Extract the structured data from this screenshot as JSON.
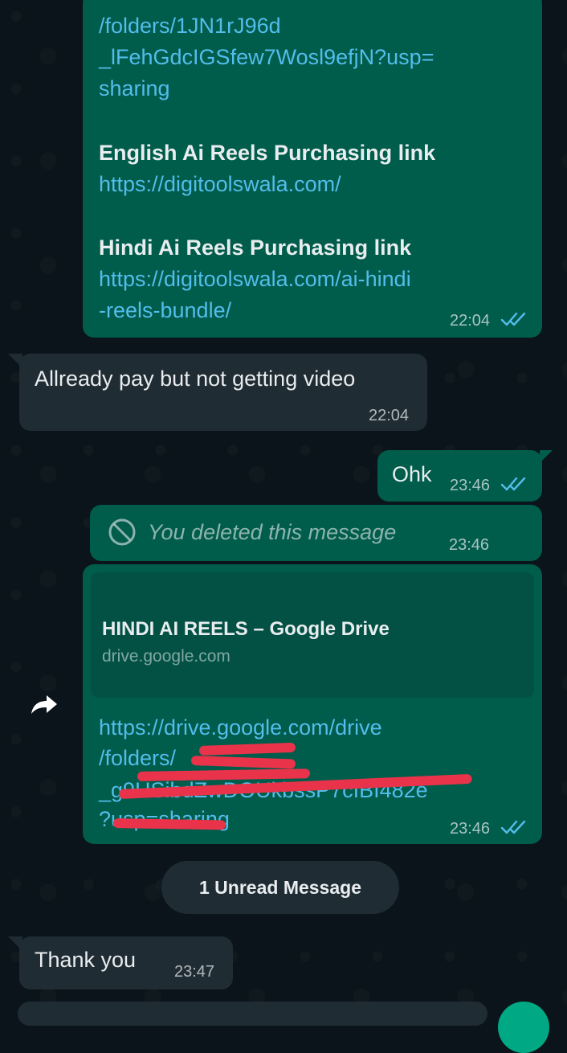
{
  "messages": {
    "m1": {
      "lines": [
        "/folders/1JN1rJ96d",
        "_lFehGdcIGSfew7Wosl9efjN?usp=",
        "sharing"
      ],
      "english_heading": "English Ai Reels Purchasing link",
      "english_link": "https://digitoolswala.com/",
      "hindi_heading": "Hindi Ai Reels Purchasing link",
      "hindi_link_1": "https://digitoolswala.com/ai-hindi",
      "hindi_link_2": "-reels-bundle/",
      "time": "22:04"
    },
    "m2": {
      "text": "Allready pay but not getting video",
      "time": "22:04"
    },
    "m3": {
      "text": "Ohk",
      "time": "23:46"
    },
    "m4": {
      "text": "You deleted this message",
      "time": "23:46"
    },
    "m5": {
      "preview_title": "HINDI AI REELS – Google Drive",
      "preview_domain": "drive.google.com",
      "link_line_1": "https://drive.google.com/drive",
      "link_line_2": "/folders/",
      "link_line_3": "_g9HSibdZwDOUkbssP7cIBI482e",
      "link_line_4": "?usp=sharing",
      "time": "23:46"
    },
    "m6": {
      "text": "Thank you",
      "time": "23:47"
    }
  },
  "unread_divider": "1 Unread Message",
  "icons": {
    "read_ticks": "double-check-icon",
    "deleted": "blocked-icon",
    "forward": "forward-arrow-icon"
  },
  "colors": {
    "background": "#0b141a",
    "outgoing_bubble": "#005c4b",
    "incoming_bubble": "#202c33",
    "link": "#53bdeb",
    "read_ticks": "#53bdeb",
    "redaction": "#e8334a"
  }
}
